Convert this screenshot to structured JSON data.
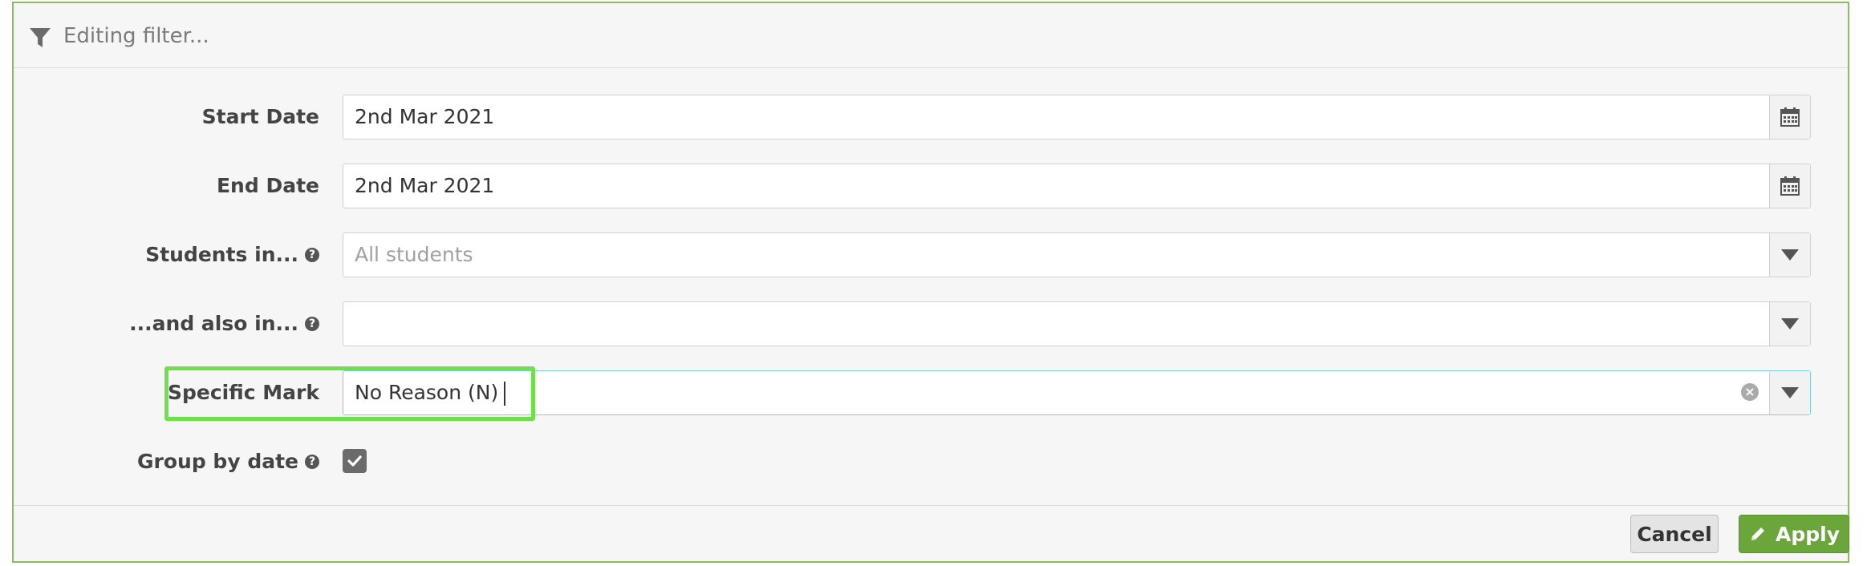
{
  "header": {
    "title": "Editing filter...",
    "icon": "filter-icon"
  },
  "fields": {
    "start_date": {
      "label": "Start Date",
      "value": "2nd Mar 2021",
      "icon": "calendar-icon"
    },
    "end_date": {
      "label": "End Date",
      "value": "2nd Mar 2021",
      "icon": "calendar-icon"
    },
    "students_in": {
      "label": "Students in...",
      "placeholder": "All students",
      "help": "?"
    },
    "also_in": {
      "label": "...and also in...",
      "value": "",
      "help": "?"
    },
    "specific_mark": {
      "label": "Specific Mark",
      "value": "No Reason (N)"
    },
    "group_by_date": {
      "label": "Group by date",
      "help": "?",
      "checked": true
    }
  },
  "footer": {
    "cancel_label": "Cancel",
    "apply_label": "Apply"
  },
  "colors": {
    "panel_border": "#8bbd5c",
    "apply_bg": "#6aa63a",
    "highlight": "#6ee04a",
    "focus": "#7ad0d8"
  }
}
